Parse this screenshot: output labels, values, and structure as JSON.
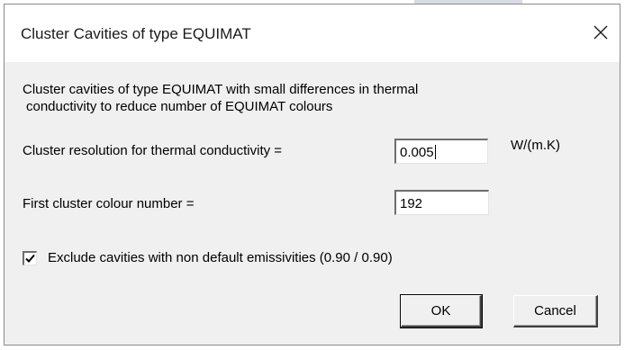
{
  "window": {
    "title": "Cluster Cavities of type EQUIMAT",
    "close_icon": "close-icon"
  },
  "description": {
    "line1": "Cluster cavities of type EQUIMAT  with small differences in thermal",
    "line2": "conductivity to reduce number of EQUIMAT colours"
  },
  "resolution": {
    "label": "Cluster resolution for thermal conductivity =",
    "value": "0.005",
    "unit": "W/(m.K)"
  },
  "first_colour": {
    "label": "First cluster colour number =",
    "value": "192"
  },
  "exclude": {
    "checked": true,
    "label": "Exclude cavities with non default emissivities (0.90 / 0.90)"
  },
  "buttons": {
    "ok": "OK",
    "cancel": "Cancel"
  },
  "colors": {
    "dialog_bg": "#f0f0f0",
    "titlebar_bg": "#ffffff"
  }
}
